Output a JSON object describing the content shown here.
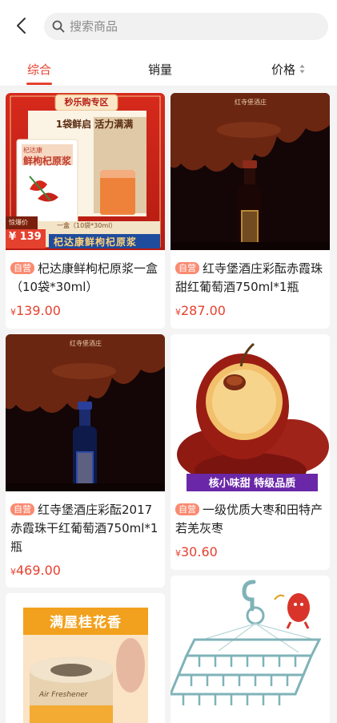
{
  "search": {
    "placeholder": "搜索商品"
  },
  "tabs": [
    {
      "label": "综合",
      "active": true
    },
    {
      "label": "销量",
      "active": false
    },
    {
      "label": "价格",
      "active": false
    }
  ],
  "products": [
    {
      "badge": "自营",
      "title": "杞达康鲜枸杞原浆一盒（10袋*30ml）",
      "currency": "¥",
      "price": "139.00",
      "image": {
        "banner": "秒乐购专区",
        "slogan": "1袋鲜启 活力满满",
        "brand": "杞达康",
        "box_text": "鲜枸杞原浆",
        "spec": "一盒（10袋*30ml）",
        "promo_label": "惊爆价",
        "promo_price": "¥ 139",
        "footer_text": "杞达康鲜枸杞原浆"
      }
    },
    {
      "badge": "自营",
      "title": "红寺堡酒庄彩酝赤霞珠甜红葡萄酒750ml*1瓶",
      "currency": "¥",
      "price": "287.00",
      "image": {
        "brand": "红寺堡酒庄"
      }
    },
    {
      "badge": "自营",
      "title": "红寺堡酒庄彩酝2017赤霞珠干红葡萄酒750ml*1瓶",
      "currency": "¥",
      "price": "469.00",
      "image": {
        "brand": "红寺堡酒庄"
      }
    },
    {
      "badge": "自营",
      "title": "一级优质大枣和田特产若羌灰枣",
      "currency": "¥",
      "price": "30.60",
      "image": {
        "caption": "核小味甜 特级品质"
      }
    },
    {
      "image": {
        "caption": "满屋桂花香",
        "jar_text": "Air Freshener"
      }
    },
    {
      "image": {}
    }
  ],
  "colors": {
    "accent": "#e5412f",
    "badge": "#fa8a70",
    "wine_bg": "#140606",
    "chocolate": "#6b2612"
  }
}
